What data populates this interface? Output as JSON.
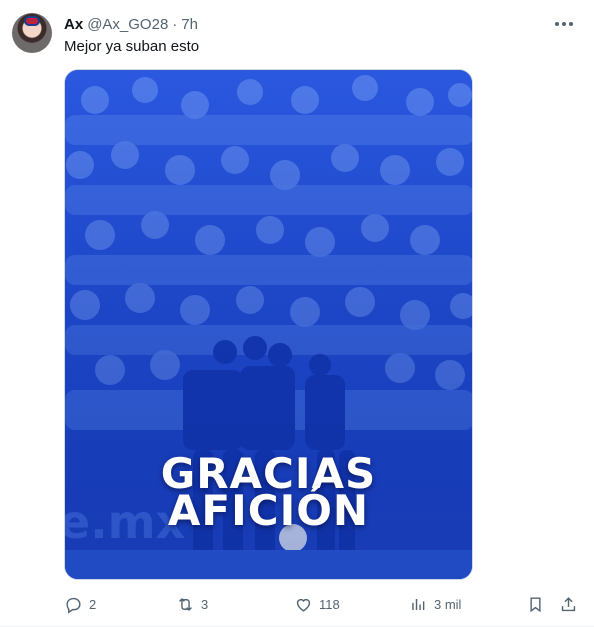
{
  "post": {
    "author_name": "Ax",
    "author_handle": "@Ax_GO28",
    "separator": "·",
    "time": "7h",
    "text": "Mejor ya suban esto",
    "media": {
      "line1": "GRACIAS",
      "line2": "AFICIÓN",
      "colors": {
        "overlay": "#1f4fd6",
        "deep": "#12308f",
        "light": "#5b86ef"
      }
    },
    "icons": {
      "more": "more-horizontal-icon",
      "reply": "reply-icon",
      "repost": "repost-icon",
      "like": "heart-icon",
      "views": "views-chart-icon",
      "bookmark": "bookmark-icon",
      "share": "share-icon"
    },
    "stats": {
      "replies": "2",
      "reposts": "3",
      "likes": "118",
      "views": "3 mil"
    }
  }
}
